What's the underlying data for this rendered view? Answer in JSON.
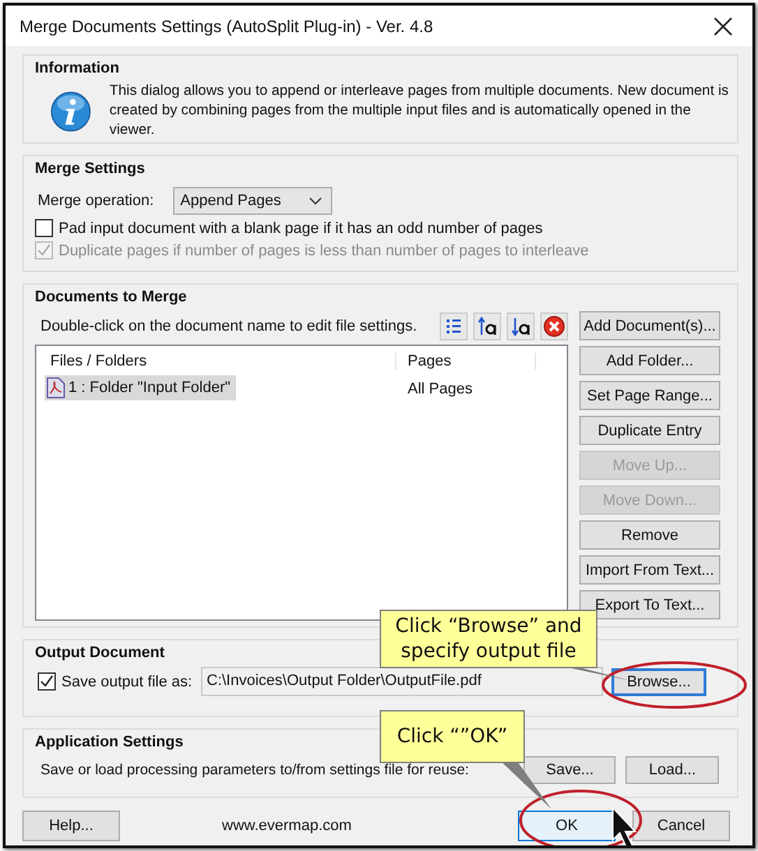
{
  "window": {
    "title": "Merge Documents Settings (AutoSplit Plug-in) - Ver. 4.8"
  },
  "information": {
    "title": "Information",
    "text": "This dialog allows you to append or interleave pages from multiple documents. New document is created by combining pages from the multiple input files and is automatically opened in the viewer."
  },
  "merge_settings": {
    "title": "Merge Settings",
    "operation_label": "Merge operation:",
    "operation_value": "Append Pages",
    "options": [
      {
        "label": "Pad input document with a blank page if it has an odd number of pages",
        "checked": false,
        "disabled": false
      },
      {
        "label": "Duplicate pages if number of pages is less than number of pages to interleave",
        "checked": true,
        "disabled": true
      }
    ]
  },
  "documents": {
    "title": "Documents to Merge",
    "hint": "Double-click on the document name to edit file settings.",
    "columns": [
      "Files / Folders",
      "Pages"
    ],
    "rows": [
      {
        "name": "1 : Folder \"Input Folder\"",
        "pages": "All Pages",
        "selected": true
      }
    ],
    "buttons": [
      {
        "label": "Add Document(s)...",
        "disabled": false
      },
      {
        "label": "Add Folder...",
        "disabled": false
      },
      {
        "label": "Set Page Range...",
        "disabled": false
      },
      {
        "label": "Duplicate Entry",
        "disabled": false
      },
      {
        "label": "Move Up...",
        "disabled": true
      },
      {
        "label": "Move Down...",
        "disabled": true
      },
      {
        "label": "Remove",
        "disabled": false
      },
      {
        "label": "Import From Text...",
        "disabled": false
      },
      {
        "label": "Export To Text...",
        "disabled": false
      }
    ]
  },
  "output": {
    "title": "Output Document",
    "save_label": "Save output file as:",
    "save_checked": true,
    "path": "C:\\Invoices\\Output Folder\\OutputFile.pdf",
    "browse": "Browse..."
  },
  "app_settings": {
    "title": "Application Settings",
    "text": "Save or load processing parameters to/from settings file for reuse:",
    "buttons": [
      "Save...",
      "Load..."
    ]
  },
  "footer": {
    "help": "Help...",
    "url": "www.evermap.com",
    "ok": "OK",
    "cancel": "Cancel"
  },
  "callouts": [
    {
      "text": "Click “Browse” and specify output file"
    },
    {
      "text": "Click “”OK”"
    }
  ]
}
